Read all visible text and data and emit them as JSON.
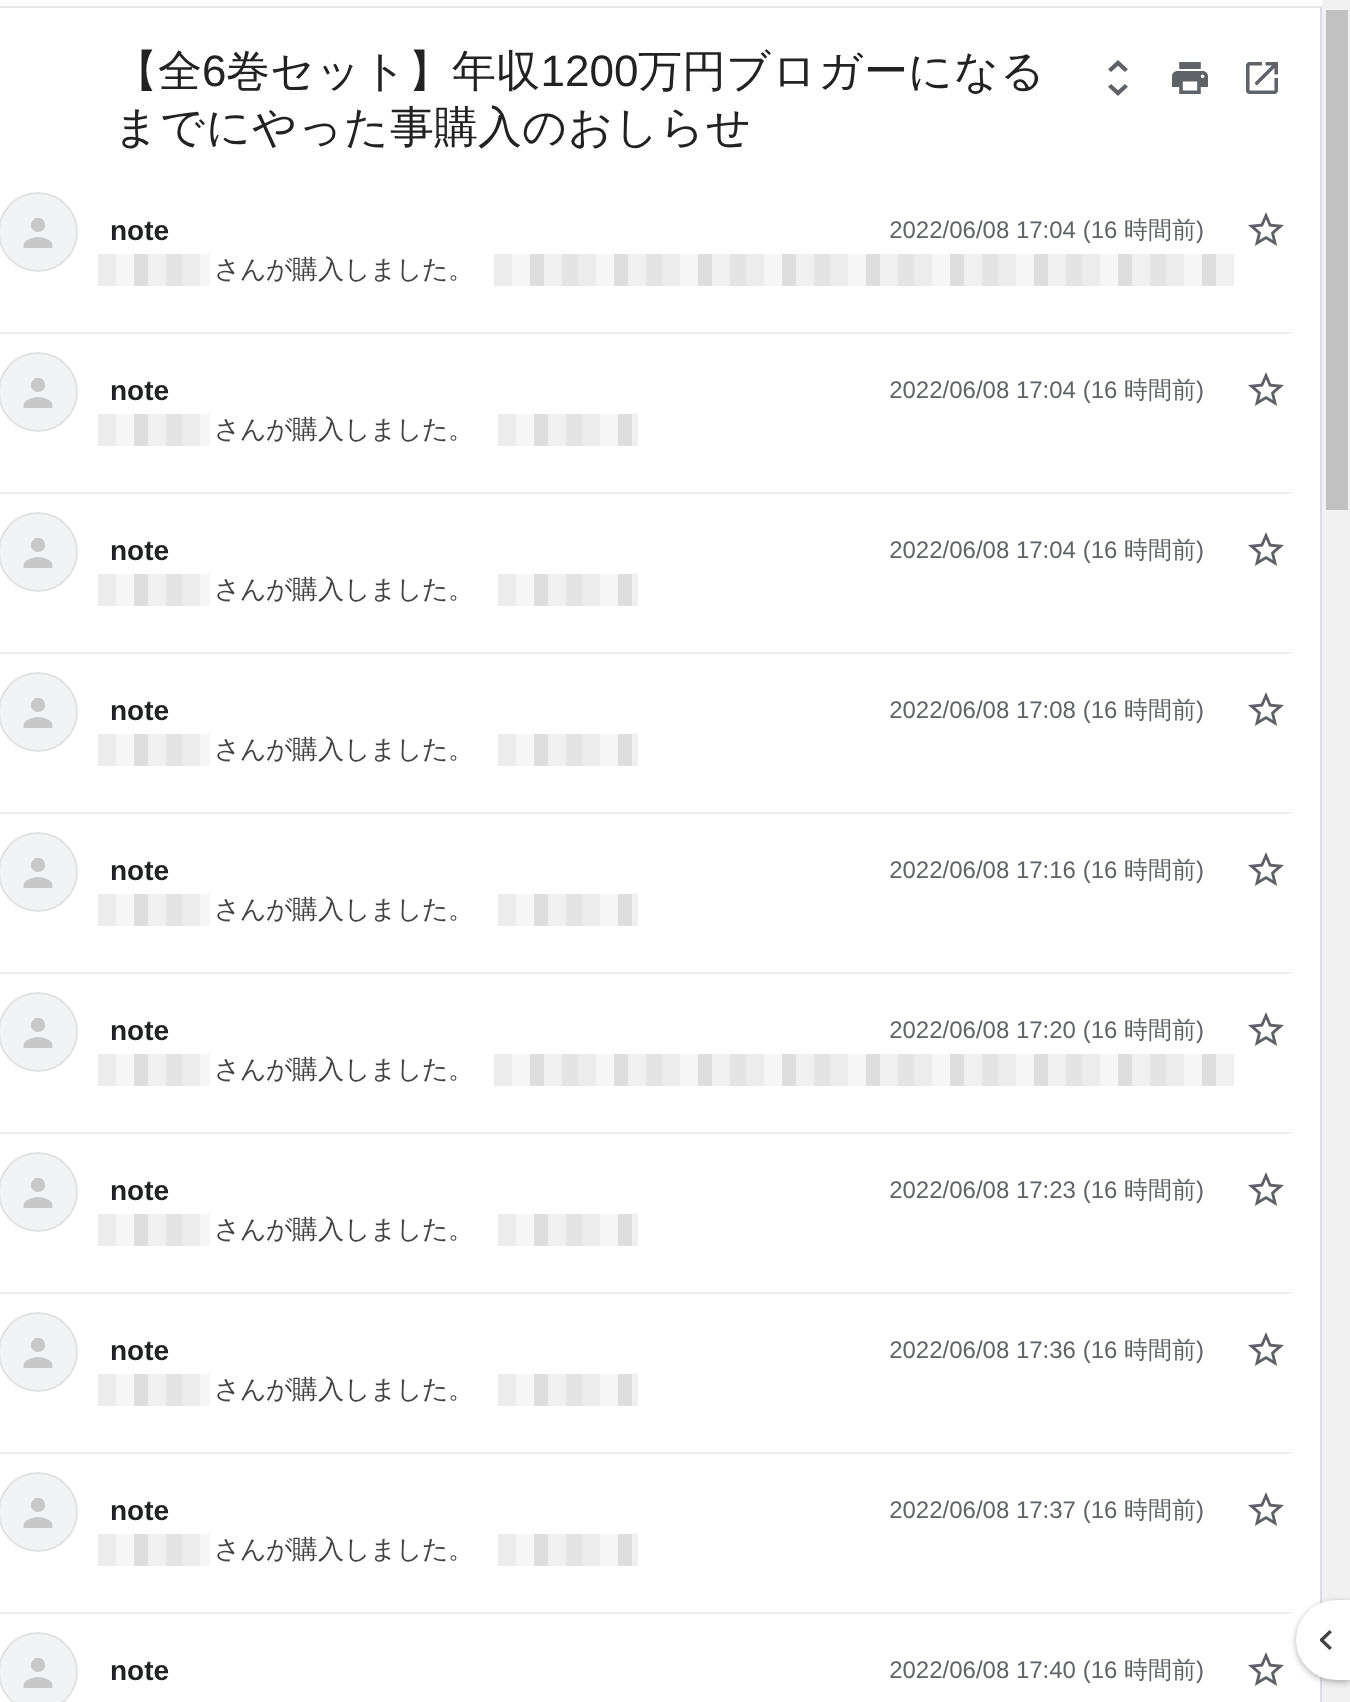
{
  "subject": "【全6巻セット】年収1200万円ブロガーになるまでにやった事購入のおしらせ",
  "messages": [
    {
      "sender": "note",
      "date": "2022/06/08 17:04 (16 時間前)",
      "snippet": "さんが購入しました。",
      "kind": "long",
      "starred": false
    },
    {
      "sender": "note",
      "date": "2022/06/08 17:04 (16 時間前)",
      "snippet": "さんが購入しました。",
      "kind": "short",
      "starred": false
    },
    {
      "sender": "note",
      "date": "2022/06/08 17:04 (16 時間前)",
      "snippet": "さんが購入しました。",
      "kind": "short",
      "starred": false
    },
    {
      "sender": "note",
      "date": "2022/06/08 17:08 (16 時間前)",
      "snippet": "さんが購入しました。",
      "kind": "short",
      "starred": false
    },
    {
      "sender": "note",
      "date": "2022/06/08 17:16 (16 時間前)",
      "snippet": "さんが購入しました。",
      "kind": "short",
      "starred": false
    },
    {
      "sender": "note",
      "date": "2022/06/08 17:20 (16 時間前)",
      "snippet": "さんが購入しました。",
      "kind": "long",
      "starred": false
    },
    {
      "sender": "note",
      "date": "2022/06/08 17:23 (16 時間前)",
      "snippet": "さんが購入しました。",
      "kind": "short",
      "starred": false
    },
    {
      "sender": "note",
      "date": "2022/06/08 17:36 (16 時間前)",
      "snippet": "さんが購入しました。",
      "kind": "short",
      "starred": false
    },
    {
      "sender": "note",
      "date": "2022/06/08 17:37 (16 時間前)",
      "snippet": "さんが購入しました。",
      "kind": "short",
      "starred": false
    },
    {
      "sender": "note",
      "date": "2022/06/08 17:40 (16 時間前)",
      "starred": false
    }
  ]
}
